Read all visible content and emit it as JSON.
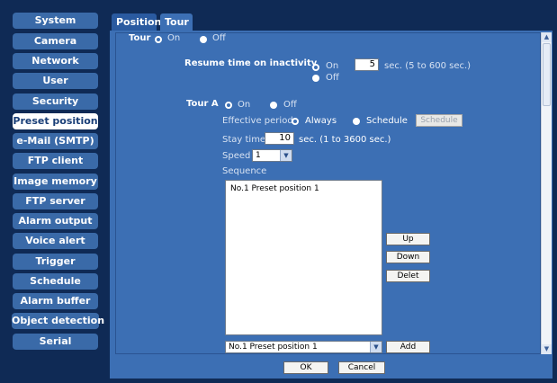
{
  "sidebar": {
    "items": [
      {
        "label": "System"
      },
      {
        "label": "Camera"
      },
      {
        "label": "Network"
      },
      {
        "label": "User"
      },
      {
        "label": "Security"
      },
      {
        "label": "Preset position",
        "active": true
      },
      {
        "label": "e-Mail (SMTP)"
      },
      {
        "label": "FTP client"
      },
      {
        "label": "Image memory"
      },
      {
        "label": "FTP server"
      },
      {
        "label": "Alarm output"
      },
      {
        "label": "Voice alert"
      },
      {
        "label": "Trigger"
      },
      {
        "label": "Schedule"
      },
      {
        "label": "Alarm buffer"
      },
      {
        "label": "Object detection"
      },
      {
        "label": "Serial"
      }
    ]
  },
  "tabs": [
    {
      "label": "Position"
    },
    {
      "label": "Tour",
      "active": true
    }
  ],
  "tour": {
    "label": "Tour",
    "on_label": "On",
    "off_label": "Off",
    "selected": "On"
  },
  "resume": {
    "label": "Resume time on inactivity",
    "on_label": "On",
    "off_label": "Off",
    "selected": "On",
    "value": "5",
    "unit": "sec. (5 to 600 sec.)"
  },
  "tour_a": {
    "label": "Tour A",
    "on_label": "On",
    "off_label": "Off",
    "selected": "On",
    "effective_period_label": "Effective period",
    "always_label": "Always",
    "schedule_label": "Schedule",
    "period_selected": "Always",
    "schedule_button": "Schedule",
    "stay_time_label": "Stay time",
    "stay_time_value": "10",
    "stay_time_unit": "sec. (1 to 3600 sec.)",
    "speed_label": "Speed",
    "speed_value": "1",
    "sequence_label": "Sequence",
    "sequence_items": [
      "No.1 Preset position 1"
    ],
    "up_button": "Up",
    "down_button": "Down",
    "delete_button": "Delet",
    "add_select_value": "No.1 Preset position 1",
    "add_button": "Add"
  },
  "footer": {
    "ok_button": "OK",
    "cancel_button": "Cancel"
  },
  "colors": {
    "background": "#0f2a55",
    "sidebar_button": "#3a6aa8",
    "panel": "#3c6fb4",
    "active_text": "#1a3f78"
  }
}
